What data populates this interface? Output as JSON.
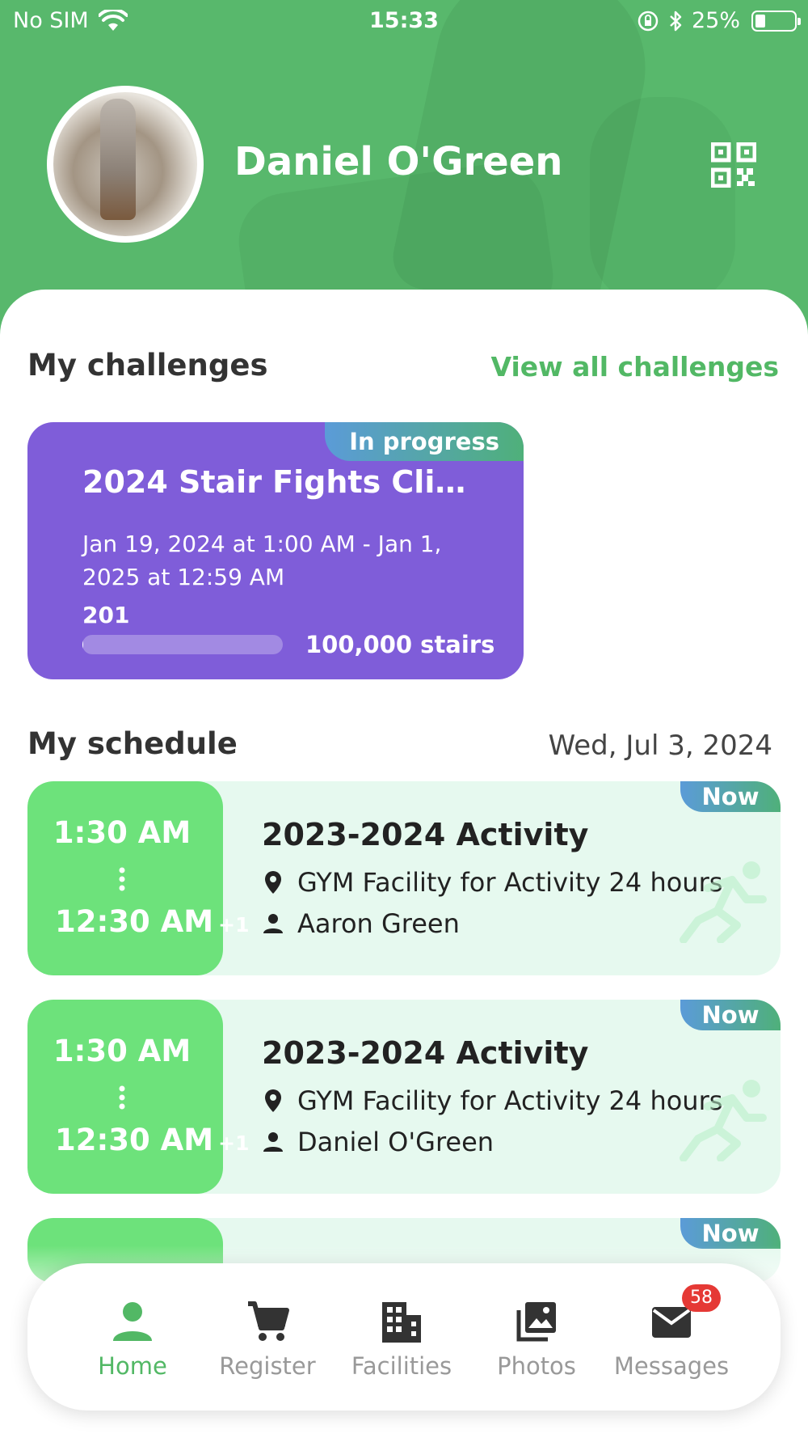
{
  "status_bar": {
    "carrier": "No SIM",
    "time": "15:33",
    "battery": "25%"
  },
  "profile": {
    "name": "Daniel O'Green"
  },
  "challenges": {
    "title": "My challenges",
    "view_all": "View all challenges",
    "card": {
      "status": "In progress",
      "name": "2024 Stair Fights Climb…",
      "dates": "Jan 19, 2024 at 1:00 AM - Jan 1, 2025 at 12:59 AM",
      "current": "201",
      "goal": "100,000 stairs",
      "progress_fraction": 0.002
    }
  },
  "schedule": {
    "title": "My schedule",
    "date": "Wed, Jul 3, 2024",
    "items": [
      {
        "start": "1:30 AM",
        "end": "12:30 AM",
        "end_offset": "+1",
        "badge": "Now",
        "activity": "2023-2024 Activity",
        "location": "GYM Facility for Activity 24 hours",
        "person": "Aaron Green"
      },
      {
        "start": "1:30 AM",
        "end": "12:30 AM",
        "end_offset": "+1",
        "badge": "Now",
        "activity": "2023-2024 Activity",
        "location": "GYM Facility for Activity 24 hours",
        "person": "Daniel O'Green"
      },
      {
        "badge": "Now"
      }
    ]
  },
  "tabbar": {
    "items": [
      {
        "label": "Home",
        "icon": "person-icon"
      },
      {
        "label": "Register",
        "icon": "cart-icon"
      },
      {
        "label": "Facilities",
        "icon": "building-icon"
      },
      {
        "label": "Photos",
        "icon": "photos-icon"
      },
      {
        "label": "Messages",
        "icon": "mail-icon",
        "badge": "58"
      }
    ]
  },
  "colors": {
    "brand_green": "#58b86c",
    "challenge_purple": "#7f5dd9",
    "time_green": "#6de27b",
    "link_green": "#52b865"
  }
}
